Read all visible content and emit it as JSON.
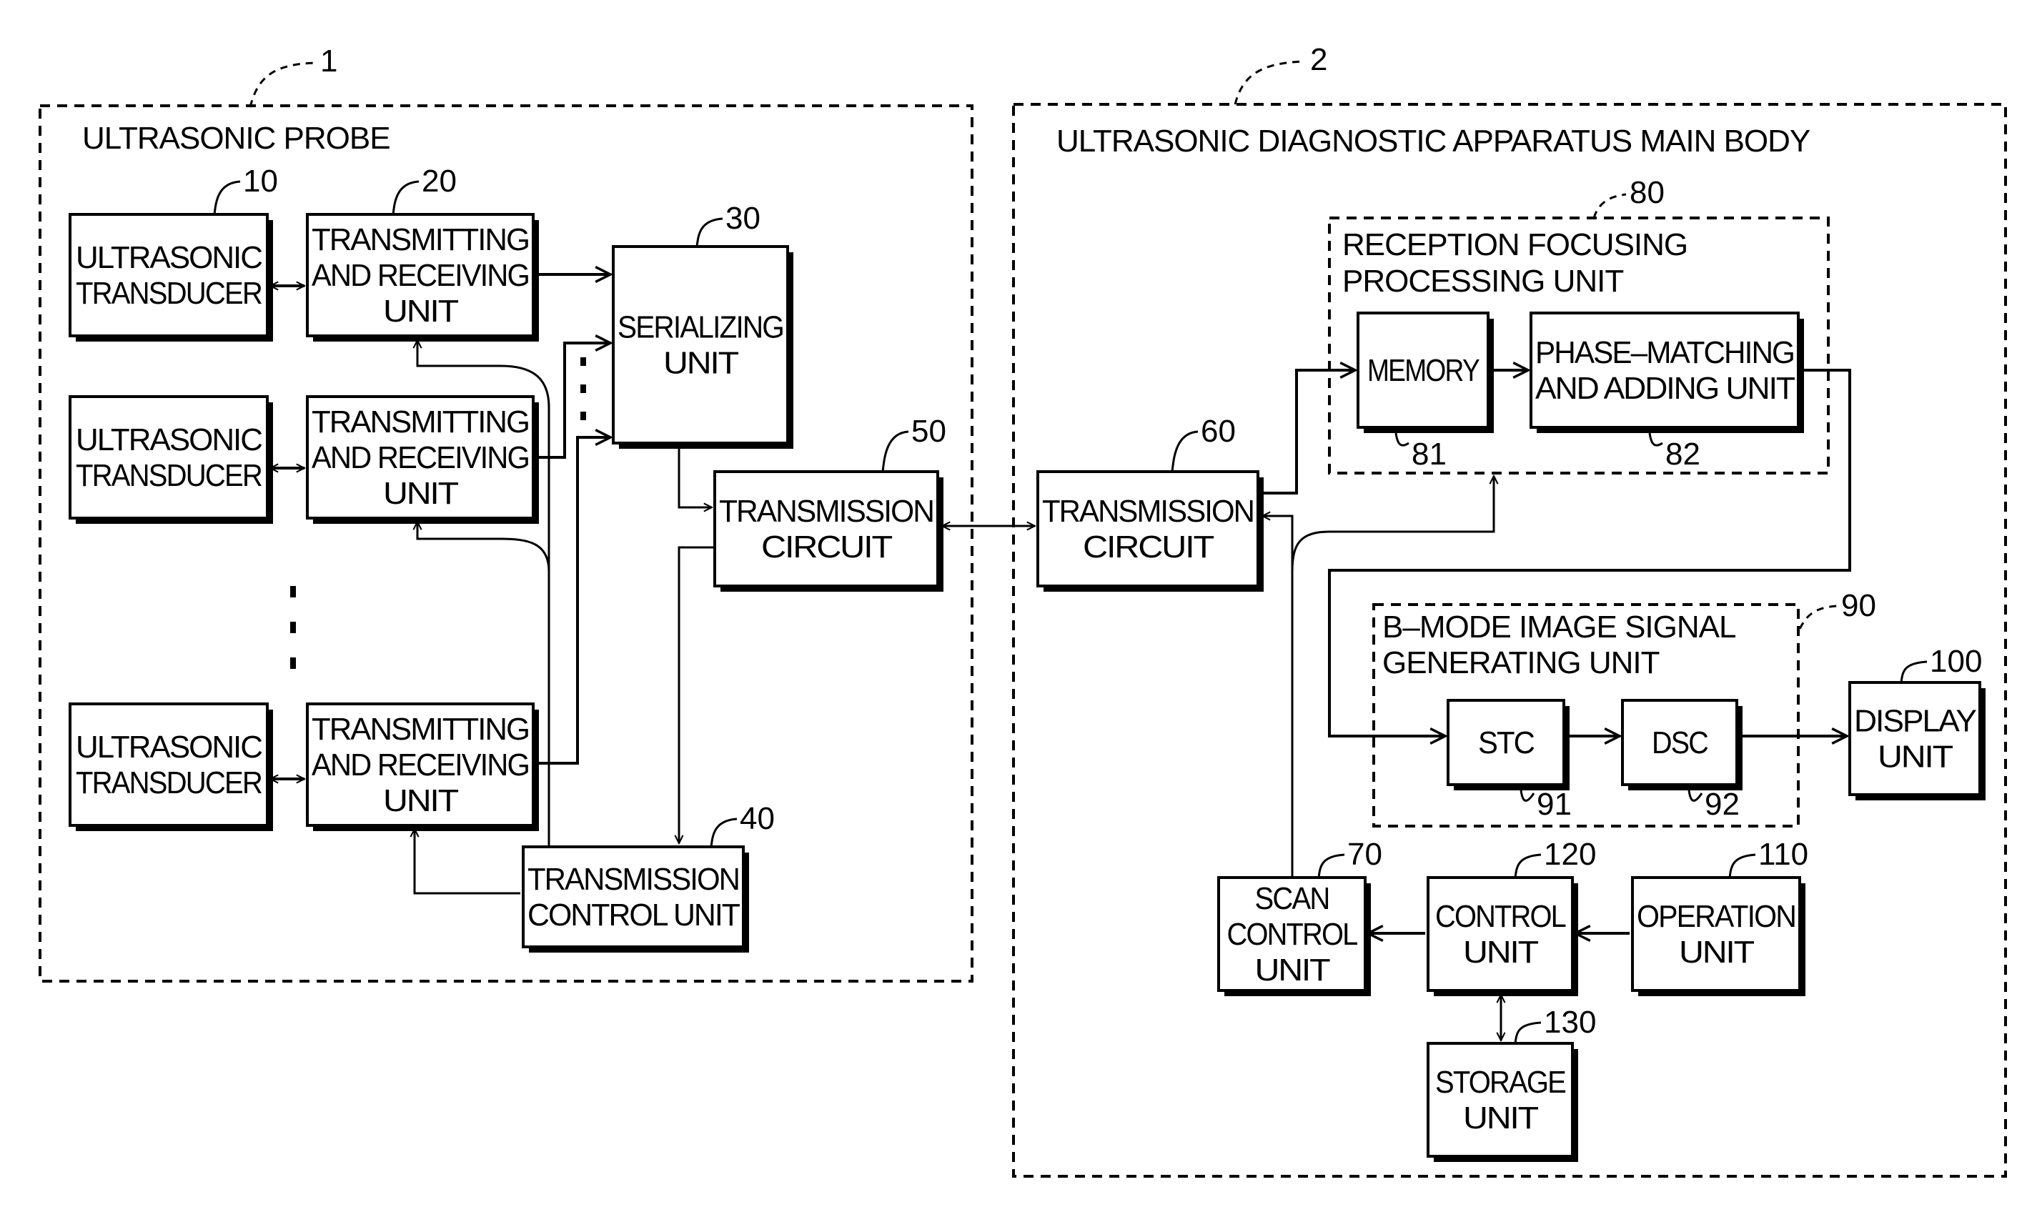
{
  "figure": {
    "groups": {
      "probe": {
        "ref": "1",
        "title": "ULTRASONIC PROBE"
      },
      "main_body": {
        "ref": "2",
        "title": "ULTRASONIC DIAGNOSTIC APPARATUS MAIN BODY"
      },
      "reception_focusing": {
        "ref": "80",
        "title_lines": [
          "RECEPTION FOCUSING",
          "PROCESSING UNIT"
        ]
      },
      "b_mode": {
        "ref": "90",
        "title_lines": [
          "B–MODE IMAGE SIGNAL",
          "GENERATING UNIT"
        ]
      }
    },
    "blocks": {
      "transducer_1": {
        "ref": "10",
        "lines": [
          "ULTRASONIC",
          "TRANSDUCER"
        ]
      },
      "transducer_2": {
        "ref": "",
        "lines": [
          "ULTRASONIC",
          "TRANSDUCER"
        ]
      },
      "transducer_3": {
        "ref": "",
        "lines": [
          "ULTRASONIC",
          "TRANSDUCER"
        ]
      },
      "tr_unit_1": {
        "ref": "20",
        "lines": [
          "TRANSMITTING",
          "AND RECEIVING",
          "UNIT"
        ]
      },
      "tr_unit_2": {
        "ref": "",
        "lines": [
          "TRANSMITTING",
          "AND RECEIVING",
          "UNIT"
        ]
      },
      "tr_unit_3": {
        "ref": "",
        "lines": [
          "TRANSMITTING",
          "AND RECEIVING",
          "UNIT"
        ]
      },
      "serializing": {
        "ref": "30",
        "lines": [
          "SERIALIZING",
          "UNIT"
        ]
      },
      "transmission_control": {
        "ref": "40",
        "lines": [
          "TRANSMISSION",
          "CONTROL UNIT"
        ]
      },
      "transmission_circuit_probe": {
        "ref": "50",
        "lines": [
          "TRANSMISSION",
          "CIRCUIT"
        ]
      },
      "transmission_circuit_main": {
        "ref": "60",
        "lines": [
          "TRANSMISSION",
          "CIRCUIT"
        ]
      },
      "memory": {
        "ref": "81",
        "lines": [
          "MEMORY"
        ]
      },
      "phase_matching": {
        "ref": "82",
        "lines": [
          "PHASE–MATCHING",
          "AND ADDING UNIT"
        ]
      },
      "stc": {
        "ref": "91",
        "lines": [
          "STC"
        ]
      },
      "dsc": {
        "ref": "92",
        "lines": [
          "DSC"
        ]
      },
      "display": {
        "ref": "100",
        "lines": [
          "DISPLAY",
          "UNIT"
        ]
      },
      "scan_control": {
        "ref": "70",
        "lines": [
          "SCAN",
          "CONTROL",
          "UNIT"
        ]
      },
      "control": {
        "ref": "120",
        "lines": [
          "CONTROL",
          "UNIT"
        ]
      },
      "operation": {
        "ref": "110",
        "lines": [
          "OPERATION",
          "UNIT"
        ]
      },
      "storage": {
        "ref": "130",
        "lines": [
          "STORAGE",
          "UNIT"
        ]
      }
    },
    "connections": [
      {
        "from": "transducer_1",
        "to": "tr_unit_1",
        "type": "bidirectional"
      },
      {
        "from": "transducer_2",
        "to": "tr_unit_2",
        "type": "bidirectional"
      },
      {
        "from": "transducer_3",
        "to": "tr_unit_3",
        "type": "bidirectional"
      },
      {
        "from": "tr_unit_1",
        "to": "serializing",
        "type": "arrow"
      },
      {
        "from": "tr_unit_2",
        "to": "serializing",
        "type": "arrow"
      },
      {
        "from": "tr_unit_3",
        "to": "serializing",
        "type": "arrow"
      },
      {
        "from": "serializing",
        "to": "transmission_circuit_probe",
        "type": "arrow"
      },
      {
        "from": "transmission_circuit_probe",
        "to": "transmission_control",
        "type": "arrow"
      },
      {
        "from": "transmission_control",
        "to": "tr_unit_1",
        "type": "arrow"
      },
      {
        "from": "transmission_control",
        "to": "tr_unit_2",
        "type": "arrow"
      },
      {
        "from": "transmission_control",
        "to": "tr_unit_3",
        "type": "arrow"
      },
      {
        "from": "transmission_circuit_probe",
        "to": "transmission_circuit_main",
        "type": "bidirectional"
      },
      {
        "from": "transmission_circuit_main",
        "to": "memory",
        "type": "arrow"
      },
      {
        "from": "memory",
        "to": "phase_matching",
        "type": "arrow"
      },
      {
        "from": "phase_matching",
        "to": "stc",
        "type": "arrow"
      },
      {
        "from": "stc",
        "to": "dsc",
        "type": "arrow"
      },
      {
        "from": "dsc",
        "to": "display",
        "type": "arrow"
      },
      {
        "from": "scan_control",
        "to": "transmission_circuit_main",
        "type": "arrow"
      },
      {
        "from": "scan_control",
        "to": "reception_focusing",
        "type": "arrow"
      },
      {
        "from": "control",
        "to": "scan_control",
        "type": "arrow"
      },
      {
        "from": "operation",
        "to": "control",
        "type": "arrow"
      },
      {
        "from": "control",
        "to": "storage",
        "type": "bidirectional"
      }
    ]
  }
}
